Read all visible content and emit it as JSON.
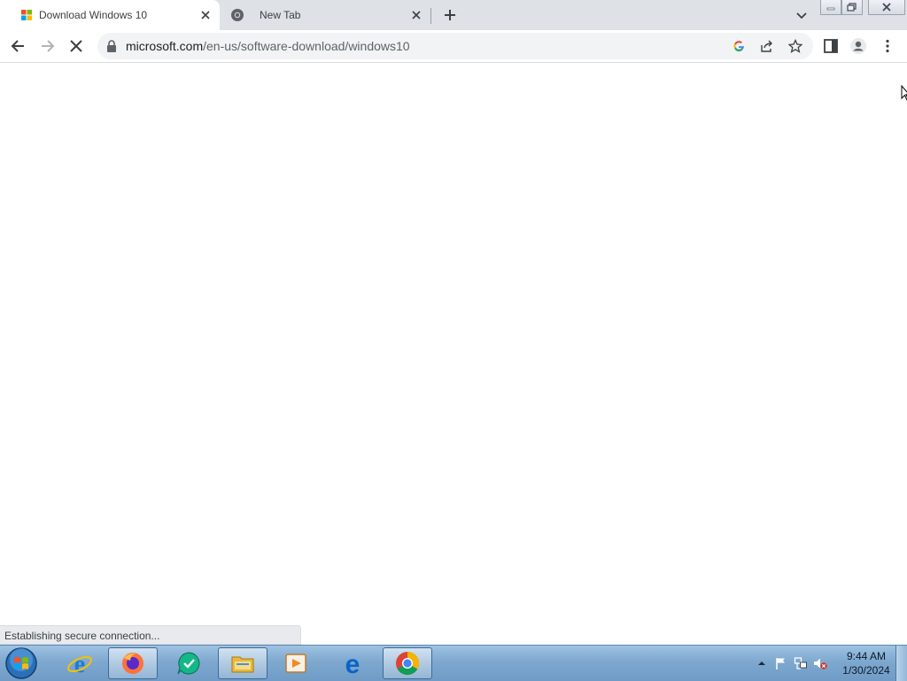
{
  "tabs": [
    {
      "title": "Download Windows 10",
      "active": true,
      "favicon": "microsoft-logo-icon"
    },
    {
      "title": "New Tab",
      "active": false,
      "favicon": "chrome-icon"
    }
  ],
  "toolbar": {
    "url_domain": "microsoft.com",
    "url_path": "/en-us/software-download/windows10"
  },
  "status": "Establishing secure connection...",
  "taskbar": {
    "apps": [
      "internet-explorer-icon",
      "firefox-icon",
      "chat-app-icon",
      "file-explorer-icon",
      "media-player-icon",
      "edge-icon",
      "chrome-icon"
    ],
    "active_app": "chrome-icon",
    "time": "9:44 AM",
    "date": "1/30/2024"
  },
  "colors": {
    "tabstrip": "#dee1e6",
    "omnibox": "#f1f3f4",
    "taskbar": "#7ea8cf"
  }
}
